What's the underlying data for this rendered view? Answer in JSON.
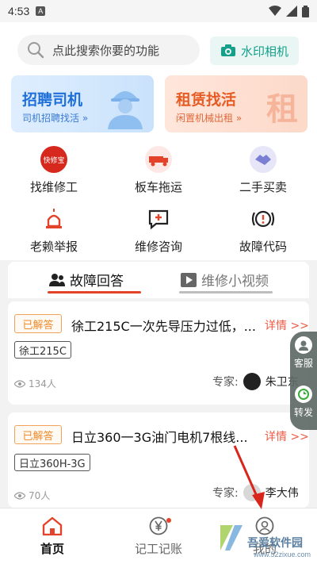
{
  "status_bar": {
    "time": "4:53",
    "badge": "A"
  },
  "search": {
    "placeholder": "点此搜索你要的功能"
  },
  "watermark_camera": {
    "label": "水印相机"
  },
  "banners": [
    {
      "title": "招聘司机",
      "subtitle": "司机招聘找活 »"
    },
    {
      "title": "租赁找活",
      "subtitle": "闲置机械出租 »",
      "big_char": "租"
    }
  ],
  "quick_menu": [
    {
      "label": "找维修工",
      "icon": "kuaixiubao-icon",
      "badge_text": "快修宝"
    },
    {
      "label": "板车拖运",
      "icon": "truck-icon"
    },
    {
      "label": "二手买卖",
      "icon": "handshake-icon"
    },
    {
      "label": "老赖举报",
      "icon": "alarm-light-icon"
    },
    {
      "label": "维修咨询",
      "icon": "chat-plus-icon"
    },
    {
      "label": "故障代码",
      "icon": "warning-code-icon"
    }
  ],
  "tabs": [
    {
      "label": "故障回答",
      "icon": "people-icon",
      "active": true
    },
    {
      "label": "维修小视频",
      "icon": "video-icon",
      "active": false
    }
  ],
  "cards": [
    {
      "status": "已解答",
      "title": "徐工215C一次先导压力过低，...",
      "detail": "详情 >>",
      "model": "徐工215C",
      "views": "134人",
      "expert_label": "专家:",
      "expert_name": "朱卫东"
    },
    {
      "status": "已解答",
      "title": "日立360一3G油门电机7根线...",
      "detail": "详情 >>",
      "model": "日立360H-3G",
      "views": "70人",
      "expert_label": "专家:",
      "expert_name": "李大伟"
    }
  ],
  "float_panel": {
    "service": "客服",
    "share": "转发"
  },
  "bottom_nav": [
    {
      "label": "首页",
      "icon": "home-icon",
      "active": true
    },
    {
      "label": "记工记账",
      "icon": "yen-icon",
      "active": false
    },
    {
      "label": "我的",
      "icon": "user-icon",
      "active": false
    }
  ],
  "overlay_watermark": {
    "text": "吾爱软件园",
    "url": "www.52zixue.com"
  },
  "colors": {
    "accent_red": "#e2432a",
    "tag_orange": "#f08a2b",
    "teal": "#15a08a",
    "blue": "#1e6fd9"
  }
}
